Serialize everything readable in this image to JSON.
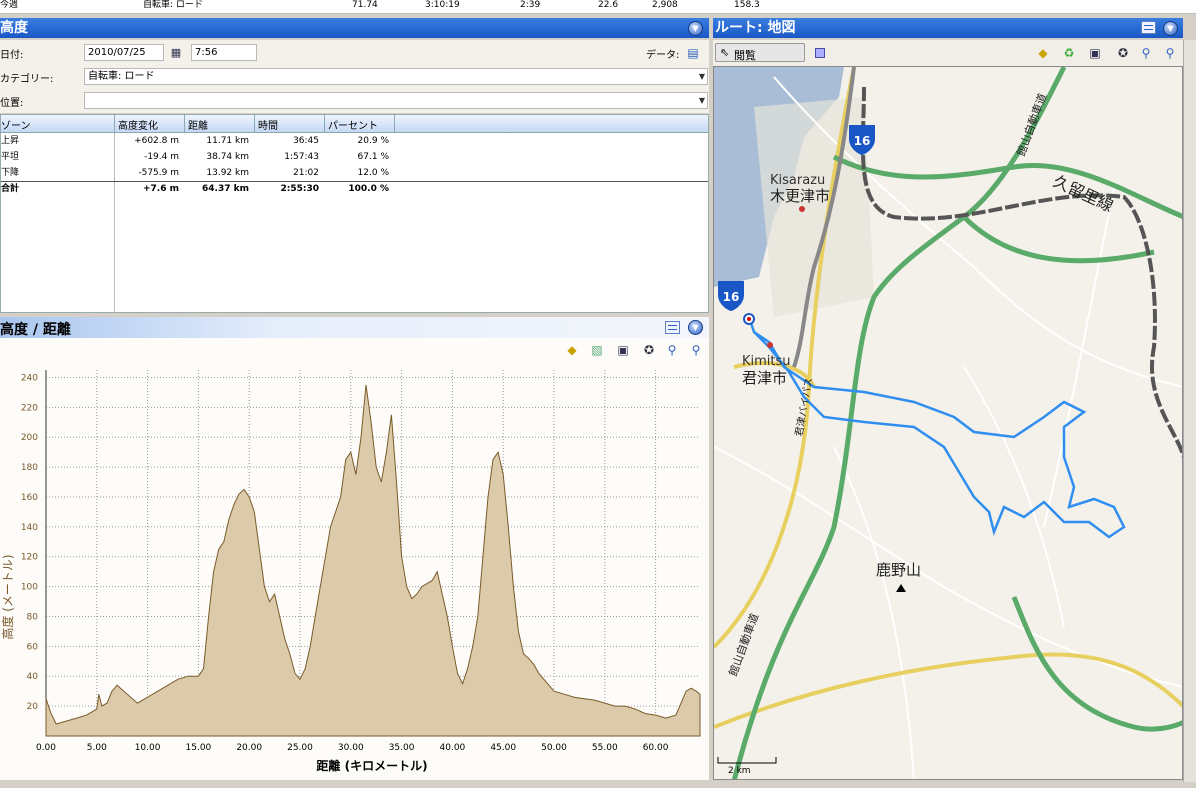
{
  "summary_row": {
    "label": "今週",
    "category": "自転車: ロード",
    "distance": "71.74",
    "time": "3:10:19",
    "pace": "2:39",
    "speed": "22.6",
    "calories": "2,908",
    "value": "158.3"
  },
  "elev_panel": {
    "title": "高度",
    "date_label": "日付:",
    "date_value": "2010/07/25",
    "time_value": "7:56",
    "data_label": "データ:",
    "category_label": "カテゴリー:",
    "category_value": "自転車: ロード",
    "location_label": "位置:",
    "location_value": ""
  },
  "table": {
    "headers": [
      "ゾーン",
      "高度変化",
      "距離",
      "時間",
      "パーセント"
    ],
    "rows": [
      {
        "zone": "上昇",
        "change": "+602.8 m",
        "distance": "11.71 km",
        "time": "36:45",
        "percent": "20.9 %"
      },
      {
        "zone": "平坦",
        "change": "-19.4 m",
        "distance": "38.74 km",
        "time": "1:57:43",
        "percent": "67.1 %"
      },
      {
        "zone": "下降",
        "change": "-575.9 m",
        "distance": "13.92 km",
        "time": "21:02",
        "percent": "12.0 %"
      },
      {
        "zone": "合計",
        "change": "+7.6 m",
        "distance": "64.37 km",
        "time": "2:55:30",
        "percent": "100.0 %"
      }
    ]
  },
  "chart_panel": {
    "title": "高度 / 距離"
  },
  "chart_data": {
    "type": "area",
    "xlabel": "距離 (キロメートル)",
    "ylabel": "高度 (メートル)",
    "xlim": [
      0,
      64.37
    ],
    "ylim": [
      0,
      245
    ],
    "xticks": [
      "0.00",
      "5.00",
      "10.00",
      "15.00",
      "20.00",
      "25.00",
      "30.00",
      "35.00",
      "40.00",
      "45.00",
      "50.00",
      "55.00",
      "60.00"
    ],
    "yticks": [
      "20",
      "40",
      "60",
      "80",
      "100",
      "120",
      "140",
      "160",
      "180",
      "200",
      "220",
      "240"
    ],
    "fill_color": "#dccbaa",
    "line_color": "#7a5a2a",
    "grid": true,
    "x": [
      0,
      0.5,
      1,
      2,
      3,
      4,
      5,
      5.2,
      5.5,
      6,
      6.5,
      7,
      8,
      9,
      10,
      11,
      12,
      13,
      14,
      15,
      15.5,
      16,
      16.5,
      17,
      17.5,
      18,
      18.5,
      19,
      19.5,
      20,
      20.5,
      21,
      21.5,
      22,
      22.5,
      23,
      23.5,
      24,
      24.5,
      25,
      25.5,
      26,
      26.5,
      27,
      27.5,
      28,
      28.5,
      29,
      29.5,
      30,
      30.5,
      31,
      31.5,
      32,
      32.5,
      33,
      33.5,
      34,
      34.5,
      35,
      35.5,
      36,
      36.5,
      37,
      37.5,
      38,
      38.5,
      39,
      39.5,
      40,
      40.5,
      41,
      41.5,
      42,
      42.5,
      43,
      43.5,
      44,
      44.5,
      45,
      45.5,
      46,
      46.5,
      47,
      47.5,
      48,
      48.5,
      49,
      49.5,
      50,
      51,
      52,
      53,
      54,
      55,
      56,
      57,
      58,
      59,
      60,
      61,
      62,
      63,
      63.5,
      64,
      64.37
    ],
    "y": [
      25,
      15,
      8,
      10,
      12,
      14,
      18,
      28,
      20,
      22,
      30,
      34,
      28,
      22,
      26,
      30,
      34,
      38,
      40,
      40,
      45,
      80,
      110,
      125,
      130,
      145,
      155,
      162,
      165,
      160,
      150,
      125,
      100,
      90,
      95,
      80,
      65,
      55,
      42,
      38,
      45,
      60,
      80,
      100,
      120,
      140,
      150,
      160,
      185,
      190,
      175,
      200,
      235,
      210,
      180,
      170,
      190,
      215,
      170,
      120,
      100,
      92,
      95,
      100,
      102,
      104,
      110,
      95,
      80,
      60,
      42,
      35,
      45,
      60,
      80,
      120,
      160,
      185,
      190,
      175,
      140,
      100,
      70,
      55,
      52,
      48,
      42,
      38,
      34,
      30,
      28,
      26,
      25,
      24,
      22,
      20,
      20,
      18,
      15,
      14,
      12,
      14,
      30,
      32,
      30,
      28
    ]
  },
  "map_panel": {
    "title": "ルート: 地図",
    "browse_label": "閲覧",
    "labels": {
      "kisarazu_en": "Kisarazu",
      "kisarazu_ja": "木更津市",
      "kimitsu_en": "Kimitsu",
      "kimitsu_ja": "君津市",
      "kurusato": "久留里線",
      "kanoyama": "鹿野山",
      "route16": "16",
      "route16b": "16",
      "expressway": "館山自動車道",
      "expressway2": "館山自動車道",
      "bypass": "君津バイパス"
    },
    "scale": "2 km"
  }
}
